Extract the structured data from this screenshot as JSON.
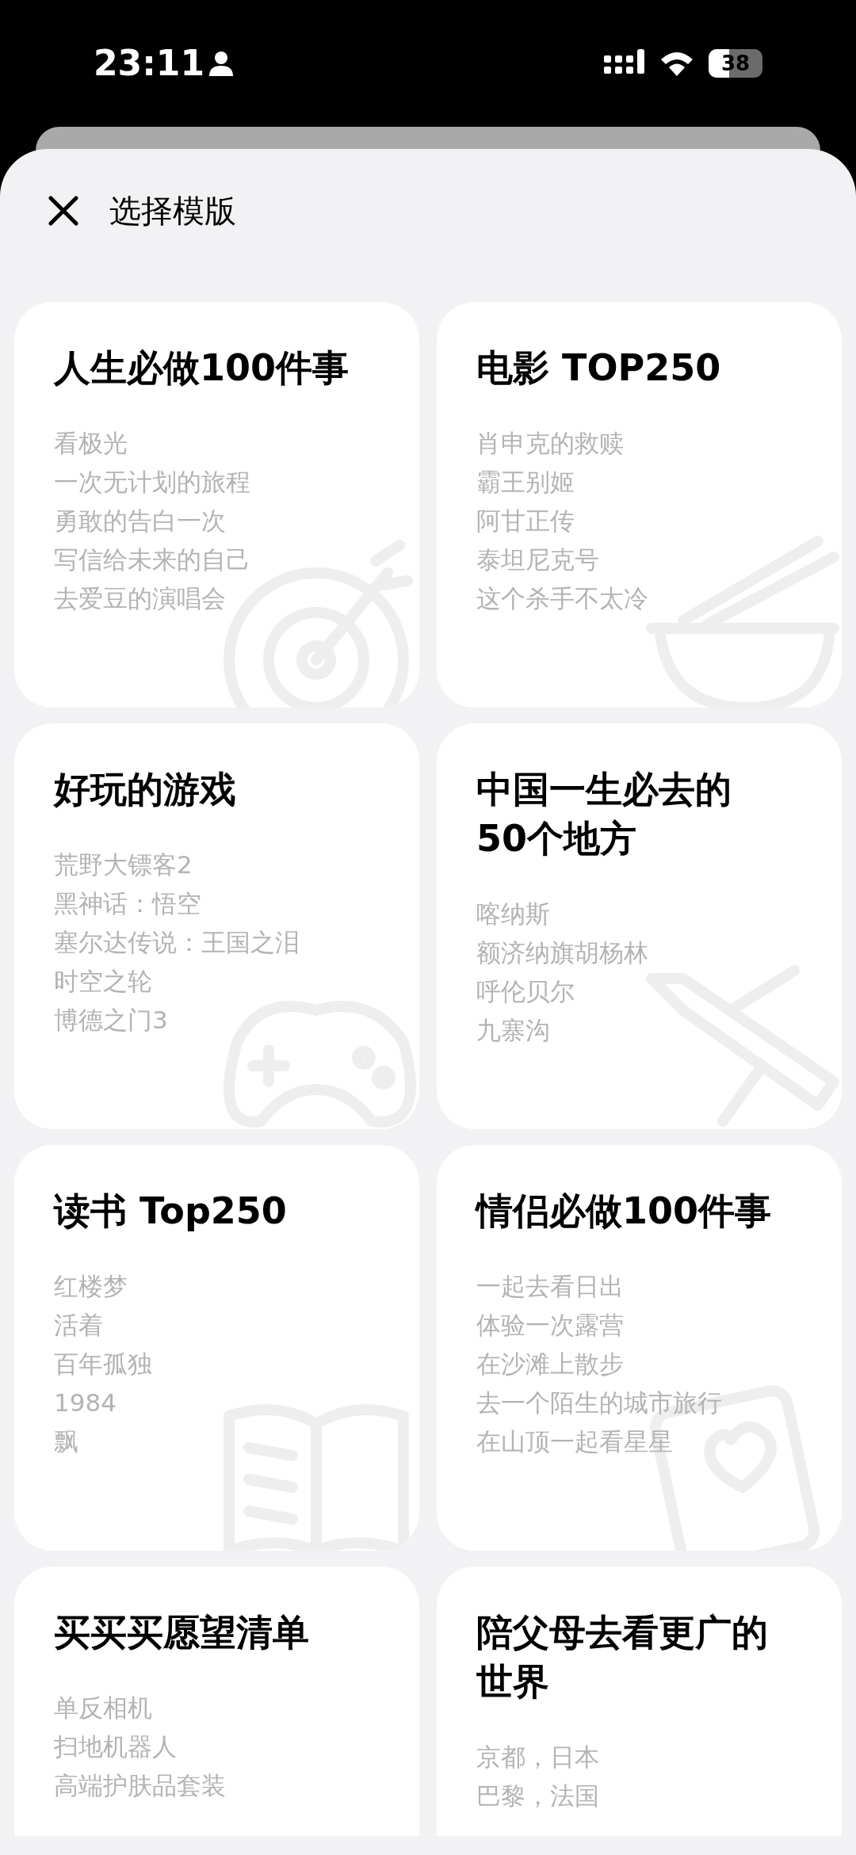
{
  "status_bar": {
    "time": "23:11",
    "battery": "38"
  },
  "header": {
    "title": "选择模版"
  },
  "templates": [
    {
      "title": "人生必做100件事",
      "items": [
        "看极光",
        "一次无计划的旅程",
        "勇敢的告白一次",
        "写信给未来的自己",
        "去爱豆的演唱会"
      ]
    },
    {
      "title": "电影 TOP250",
      "items": [
        "肖申克的救赎",
        "霸王别姬",
        "阿甘正传",
        "泰坦尼克号",
        "这个杀手不太冷"
      ]
    },
    {
      "title": "好玩的游戏",
      "items": [
        "荒野大镖客2",
        "黑神话：悟空",
        "塞尔达传说：王国之泪",
        "时空之轮",
        "博德之门3"
      ]
    },
    {
      "title": "中国一生必去的50个地方",
      "items": [
        "喀纳斯",
        "额济纳旗胡杨林",
        "呼伦贝尔",
        "九寨沟"
      ]
    },
    {
      "title": "读书 Top250",
      "items": [
        "红楼梦",
        "活着",
        "百年孤独",
        "1984",
        "飘"
      ]
    },
    {
      "title": "情侣必做100件事",
      "items": [
        "一起去看日出",
        "体验一次露营",
        "在沙滩上散步",
        "去一个陌生的城市旅行",
        "在山顶一起看星星"
      ]
    },
    {
      "title": "买买买愿望清单",
      "items": [
        "单反相机",
        "扫地机器人",
        "高端护肤品套装"
      ]
    },
    {
      "title": "陪父母去看更广的世界",
      "items": [
        "京都，日本",
        "巴黎，法国"
      ]
    }
  ]
}
